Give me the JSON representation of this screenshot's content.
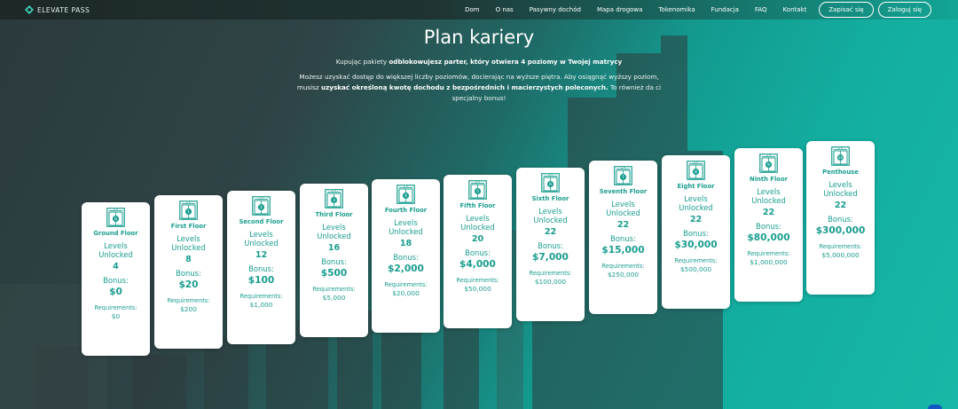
{
  "nav": {
    "logo_text": "ELEVATE PASS",
    "links": [
      "Dom",
      "O nas",
      "Pasywny dochód",
      "Mapa drogowa",
      "Tokenomika",
      "Fundacja",
      "FAQ",
      "Kontakt"
    ],
    "register_label": "Zapisać się",
    "login_label": "Zaloguj się"
  },
  "hero": {
    "title": "Plan kariery",
    "line1_pre": "Kupując pakiety ",
    "line1_bold": "odblokowujesz parter, który otwiera 4 poziomy w Twojej matrycy",
    "line2": "Możesz uzyskać dostęp do większej liczby poziomów, docierając na wyższe piętra. Aby osiągnąć wyższy poziom,",
    "line3_pre": "musisz ",
    "line3_bold": "uzyskać określoną kwotę dochodu z bezpośrednich i macierzystych poleconych.",
    "line3_post": " To również da ci",
    "line4": "specjalny bonus!"
  },
  "labels": {
    "levels": "Levels Unlocked",
    "bonus": "Bonus:",
    "requirements": "Requirements:"
  },
  "floors": [
    {
      "number": "G",
      "name": "Ground Floor",
      "levels": "4",
      "bonus": "$0",
      "requirement": "$0"
    },
    {
      "number": "1",
      "name": "First Floor",
      "levels": "8",
      "bonus": "$20",
      "requirement": "$200"
    },
    {
      "number": "2",
      "name": "Second Floor",
      "levels": "12",
      "bonus": "$100",
      "requirement": "$1,000"
    },
    {
      "number": "3",
      "name": "Third Floor",
      "levels": "16",
      "bonus": "$500",
      "requirement": "$5,000"
    },
    {
      "number": "4",
      "name": "Fourth Floor",
      "levels": "18",
      "bonus": "$2,000",
      "requirement": "$20,000"
    },
    {
      "number": "5",
      "name": "Fifth Floor",
      "levels": "20",
      "bonus": "$4,000",
      "requirement": "$50,000"
    },
    {
      "number": "6",
      "name": "Sixth Floor",
      "levels": "22",
      "bonus": "$7,000",
      "requirement": "$100,000"
    },
    {
      "number": "7",
      "name": "Seventh Floor",
      "levels": "22",
      "bonus": "$15,000",
      "requirement": "$250,000"
    },
    {
      "number": "8",
      "name": "Eight Floor",
      "levels": "22",
      "bonus": "$30,000",
      "requirement": "$500,000"
    },
    {
      "number": "9",
      "name": "Ninth Floor",
      "levels": "22",
      "bonus": "$80,000",
      "requirement": "$1,000,000"
    },
    {
      "number": "10",
      "name": "Penthouse",
      "levels": "22",
      "bonus": "$300,000",
      "requirement": "$5,000,000"
    }
  ],
  "colors": {
    "accent": "#1a9d8f",
    "card_bg": "#ffffff"
  }
}
